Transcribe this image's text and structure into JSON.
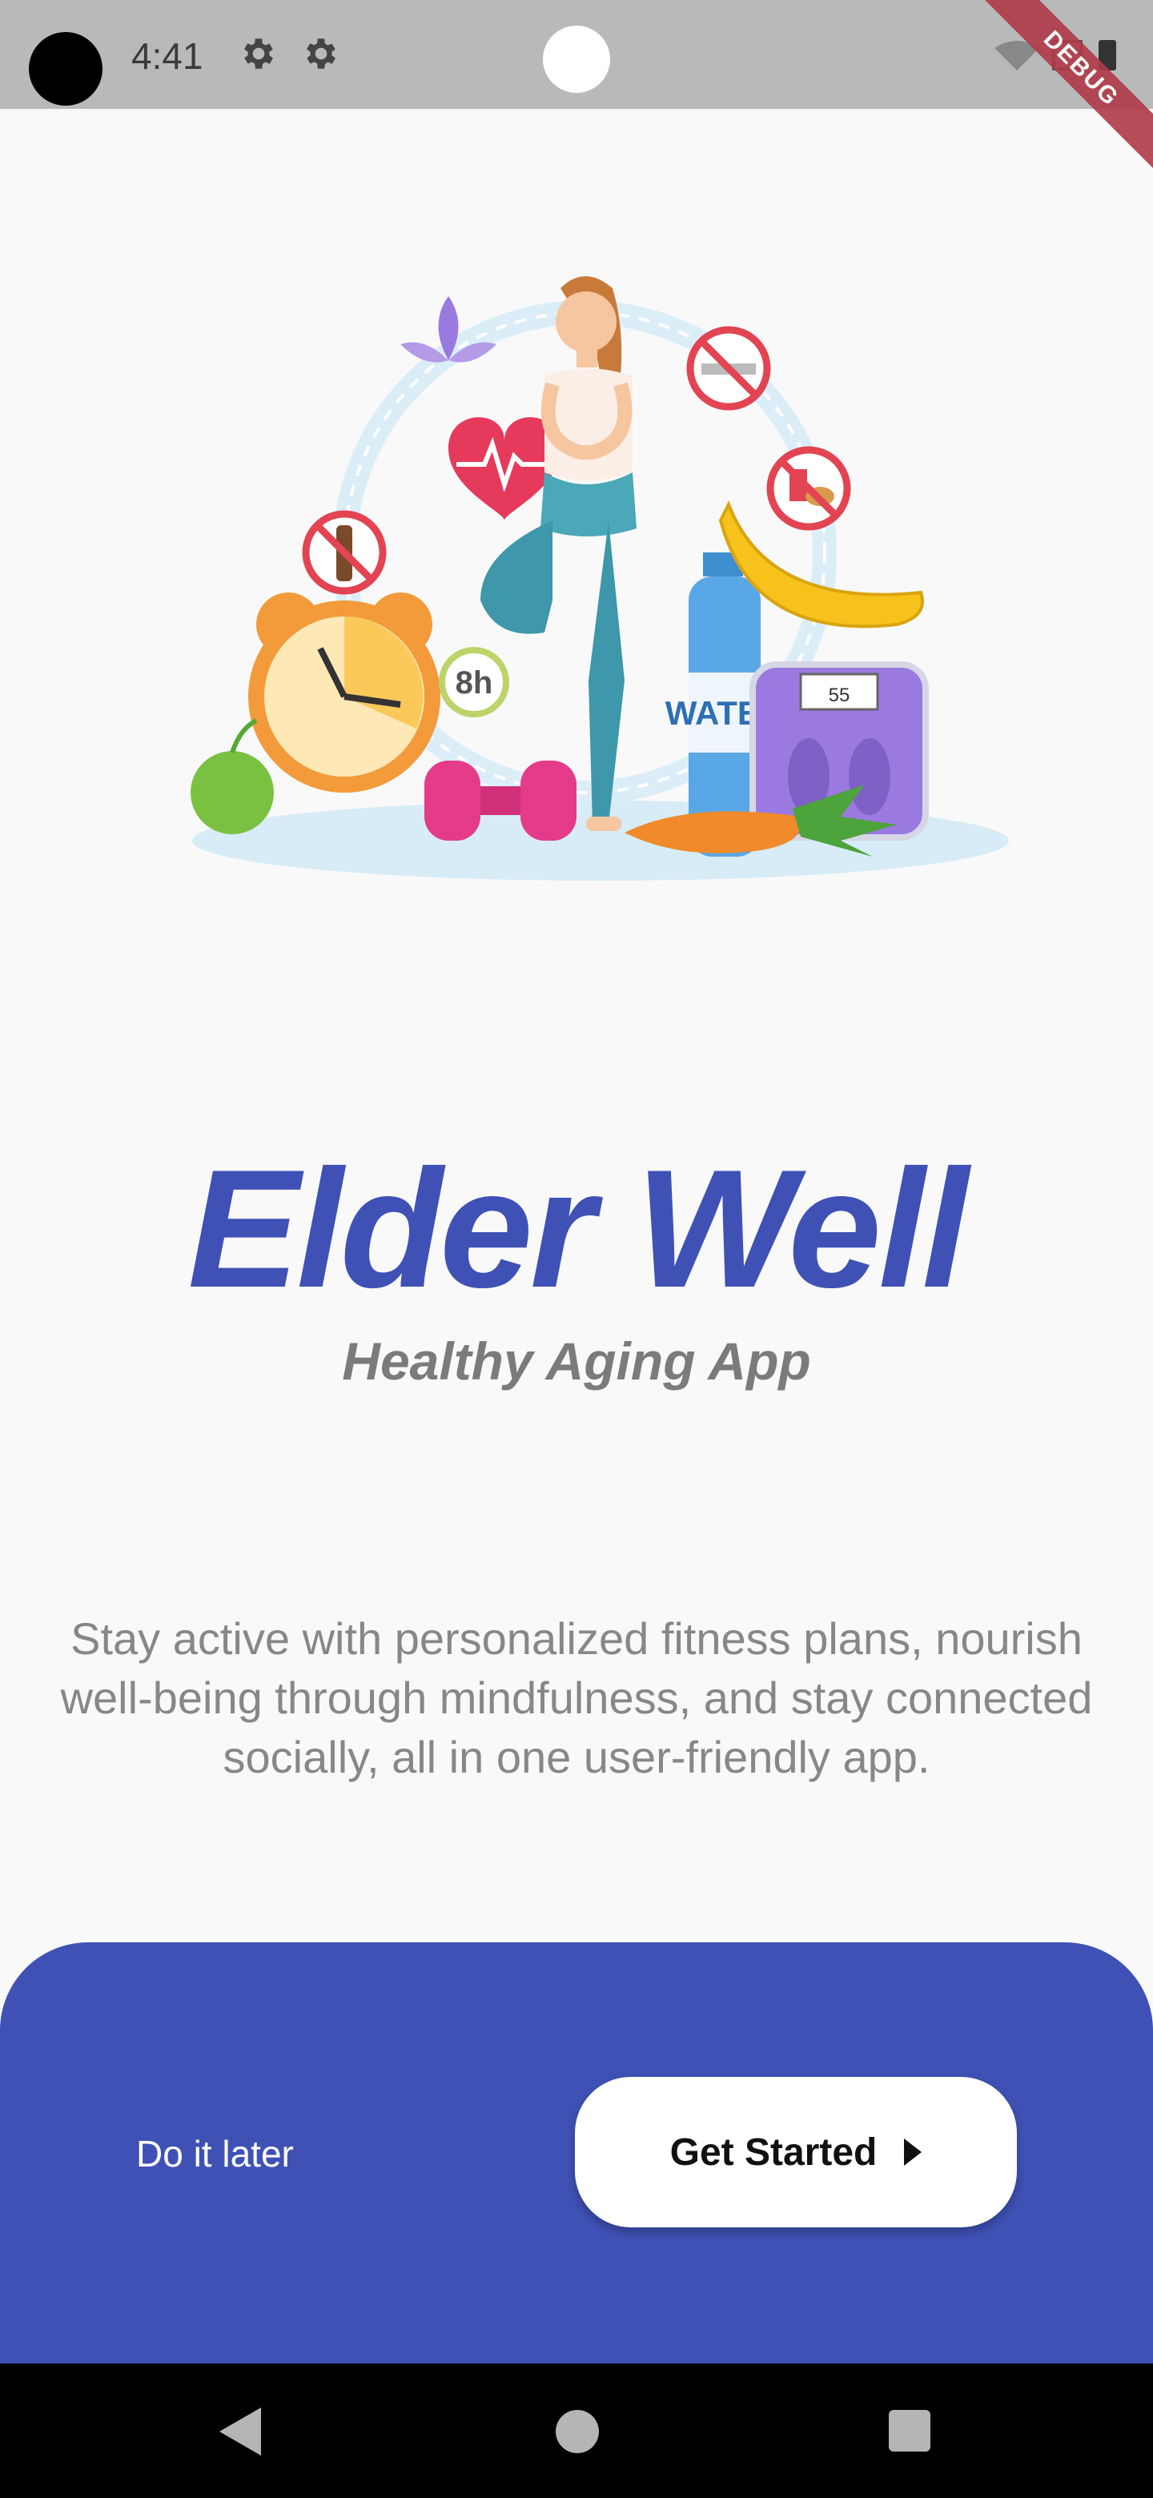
{
  "status_bar": {
    "time": "4:41",
    "icons": [
      "gear-icon",
      "gear-icon",
      "wifi-icon",
      "battery-icon"
    ],
    "debug_banner": "DEBUG"
  },
  "illustration": {
    "bottle_label": "WATER",
    "clock_badge": "8h",
    "scale_display": "55"
  },
  "app": {
    "title": "Elder Well",
    "subtitle": "Healthy Aging App",
    "description": "Stay active with personalized fitness plans, nourish well-being through mindfulness, and stay connected socially, all in one user-friendly app."
  },
  "actions": {
    "later_label": "Do it later",
    "start_label": "Get Started"
  },
  "colors": {
    "primary": "#3f51b5",
    "background": "#f9f9f9",
    "subtitle": "#7b7b7b",
    "body_text": "#878787"
  }
}
